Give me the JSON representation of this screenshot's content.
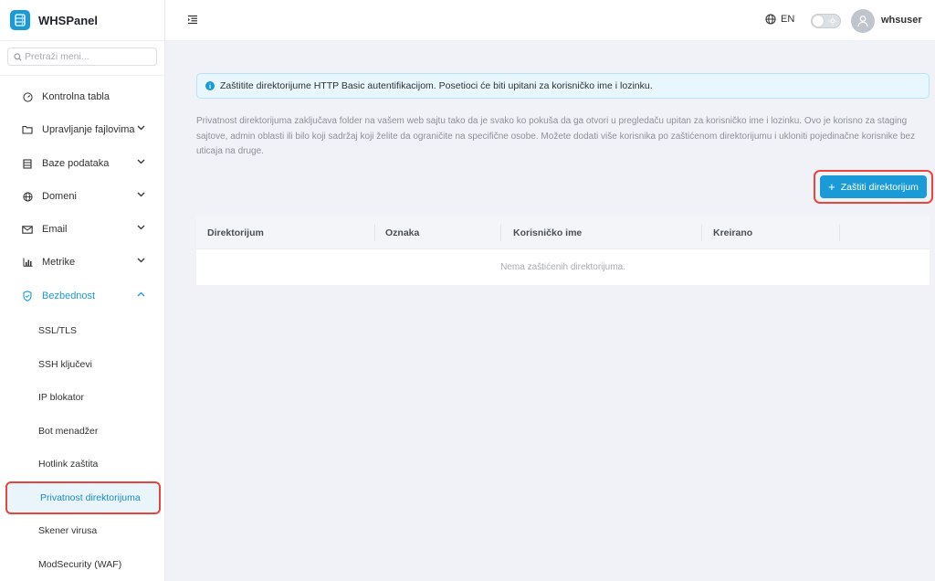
{
  "brand": {
    "name": "WHSPanel"
  },
  "sidebar": {
    "search_placeholder": "Pretraži meni...",
    "items": [
      {
        "label": "Kontrolna tabla",
        "icon": "dashboard-icon"
      },
      {
        "label": "Upravljanje fajlovima",
        "icon": "folder-icon"
      },
      {
        "label": "Baze podataka",
        "icon": "database-icon"
      },
      {
        "label": "Domeni",
        "icon": "globe-icon"
      },
      {
        "label": "Email",
        "icon": "mail-icon"
      },
      {
        "label": "Metrike",
        "icon": "bar-chart-icon"
      },
      {
        "label": "Bezbednost",
        "icon": "shield-icon"
      }
    ],
    "security_sub": [
      {
        "label": "SSL/TLS"
      },
      {
        "label": "SSH ključevi"
      },
      {
        "label": "IP blokator"
      },
      {
        "label": "Bot menadžer"
      },
      {
        "label": "Hotlink zaštita"
      },
      {
        "label": "Privatnost direktorijuma"
      },
      {
        "label": "Skener virusa"
      },
      {
        "label": "ModSecurity (WAF)"
      }
    ]
  },
  "topbar": {
    "language": "EN",
    "username": "whsuser"
  },
  "alert": {
    "text": "Zaštitite direktorijume HTTP Basic autentifikacijom. Posetioci će biti upitani za korisničko ime i lozinku."
  },
  "description": "Privatnost direktorijuma zaključava folder na vašem web sajtu tako da je svako ko pokuša da ga otvori u pregledaču upitan za korisničko ime i lozinku. Ovo je korisno za staging sajtove, admin oblasti ili bilo koji sadržaj koji želite da ograničite na specifične osobe. Možete dodati više korisnika po zaštićenom direktorijumu i ukloniti pojedinačne korisnike bez uticaja na druge.",
  "actions": {
    "protect_label": "Zaštiti direktorijum"
  },
  "table": {
    "columns": [
      "Direktorijum",
      "Oznaka",
      "Korisničko ime",
      "Kreirano"
    ],
    "empty_text": "Nema zaštićenih direktorijuma."
  },
  "colors": {
    "accent": "#1a9bd7",
    "highlight": "#e8453c"
  }
}
